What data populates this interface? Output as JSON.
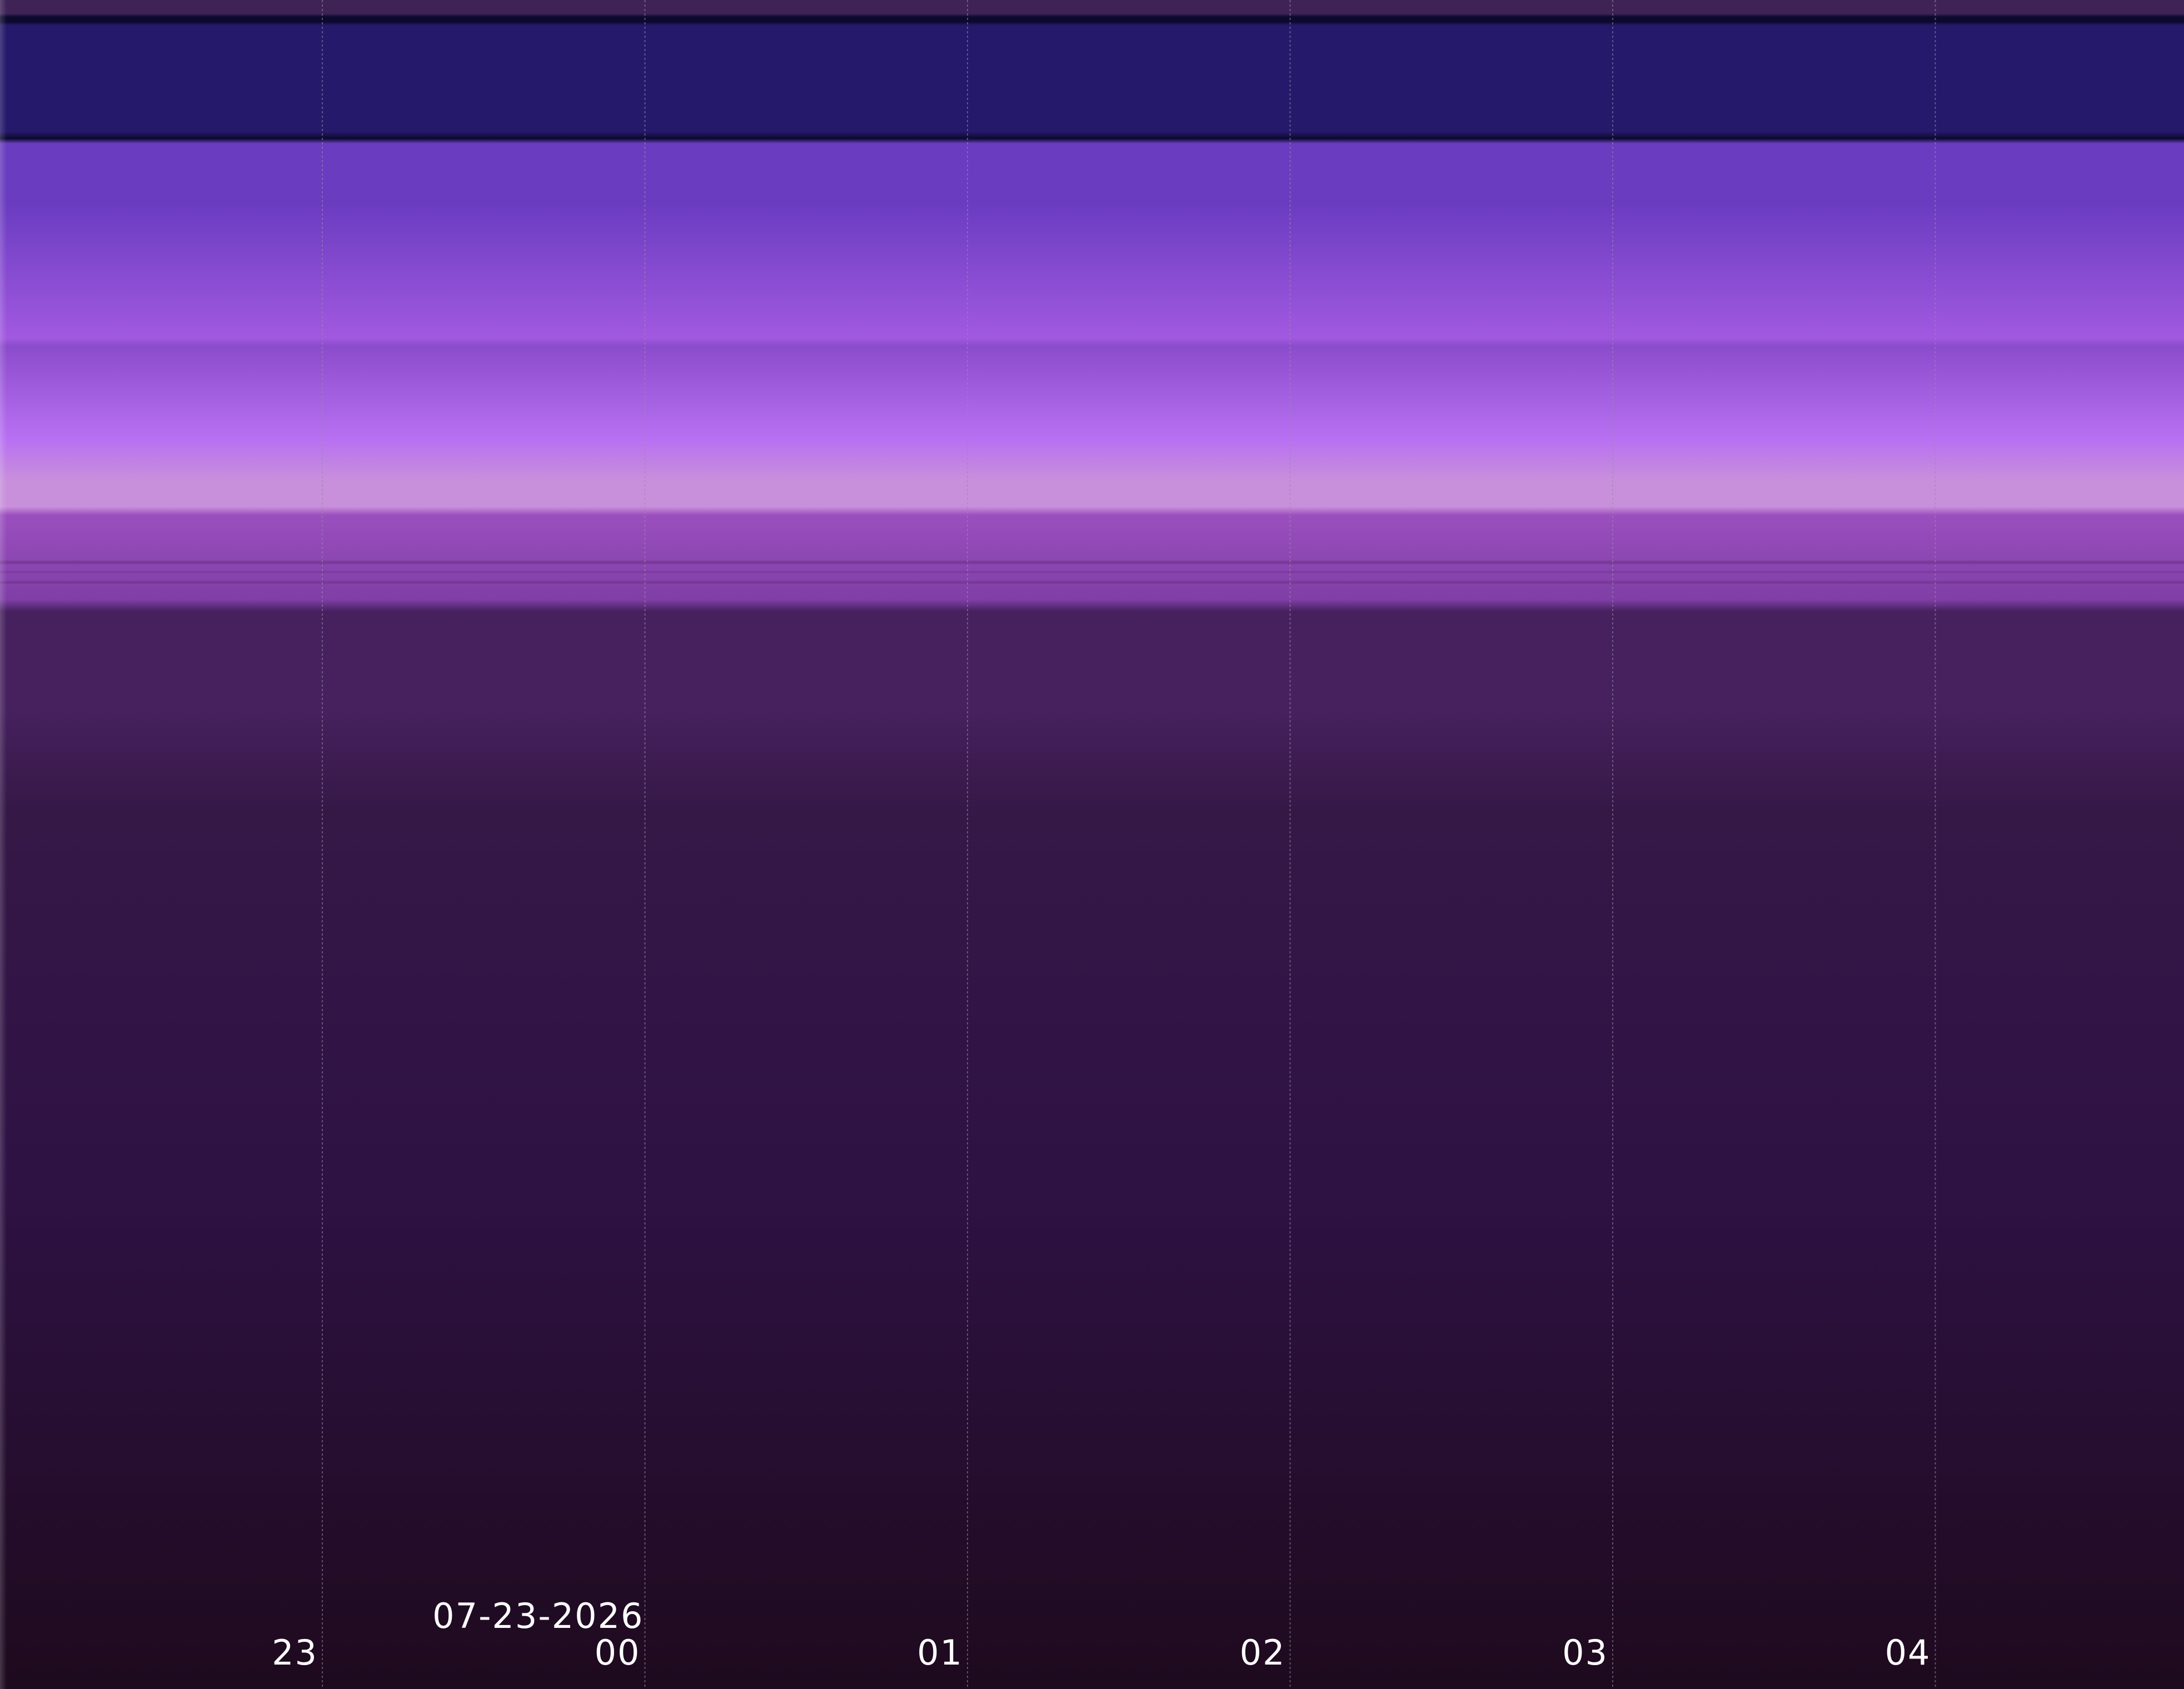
{
  "chart_data": {
    "type": "heatmap",
    "title": "",
    "xlabel": "",
    "ylabel": "",
    "grid": true,
    "x_ticks": [
      {
        "label": "23"
      },
      {
        "label": "00",
        "date_label": "07-23-2026"
      },
      {
        "label": "01"
      },
      {
        "label": "02"
      },
      {
        "label": "03"
      },
      {
        "label": "04"
      }
    ],
    "colors": {
      "grid_line": "#9a8aa6",
      "tick_text": "#ffffff",
      "band_top": "#3f2357",
      "band_dark_line": "#0b0a2e",
      "band_navy": "#24196a",
      "band_violet": "#6a3cc0",
      "band_lavender": "#a159e0",
      "band_bright": "#b870f2",
      "band_pink": "#c890da",
      "band_magenta": "#9b4fbf",
      "band_plum": "#46215e",
      "band_dark_plum": "#361847",
      "band_bottom": "#1e0a1e"
    }
  }
}
